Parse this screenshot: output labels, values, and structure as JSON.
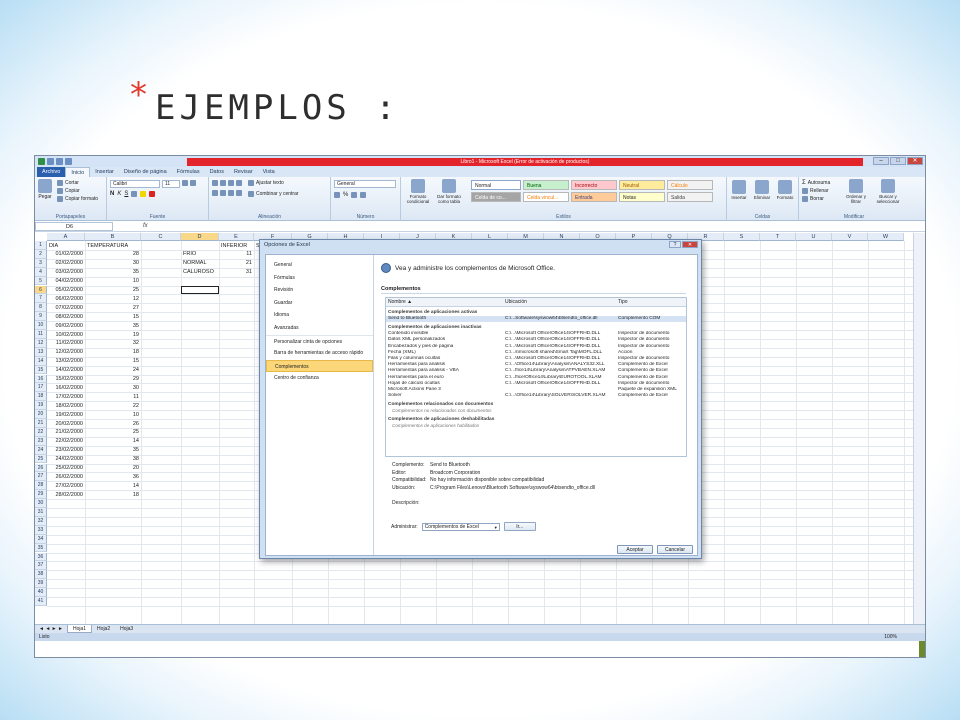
{
  "slide": {
    "star": "*",
    "title": "EJEMPLOS :"
  },
  "window": {
    "title": "Libro1 - Microsoft Excel (Error de activación de productos)",
    "controls": [
      "–",
      "□",
      "✕"
    ]
  },
  "ribbon_tabs": [
    "Archivo",
    "Inicio",
    "Insertar",
    "Diseño de página",
    "Fórmulas",
    "Datos",
    "Revisar",
    "Vista"
  ],
  "ribbon": {
    "clipboard": {
      "paste": "Pegar",
      "cut": "Cortar",
      "copy": "Copiar",
      "format": "Copiar formato",
      "label": "Portapapeles"
    },
    "font": {
      "name": "Calibri",
      "size": "11",
      "label": "Fuente"
    },
    "alignment": {
      "wrap": "Ajustar texto",
      "merge": "Combinar y centrar",
      "label": "Alineación"
    },
    "number": {
      "format": "General",
      "label": "Número"
    },
    "styles": {
      "cond": "Formato condicional",
      "table": "Dar formato como tabla",
      "cells": [
        "Normal",
        "Buena",
        "Incorrecto",
        "Neutral",
        "Cálculo",
        "Celda de co...",
        "Celda vincul...",
        "Entrada",
        "Notas",
        "Salida"
      ],
      "label": "Estilos"
    },
    "cells": {
      "insert": "Insertar",
      "delete": "Eliminar",
      "format": "Formato",
      "label": "Celdas"
    },
    "editing": {
      "autosum": "Autosuma",
      "fill": "Rellenar",
      "clear": "Borrar",
      "sort": "Ordenar y filtrar",
      "find": "Buscar y seleccionar",
      "label": "Modificar"
    }
  },
  "formula_bar": {
    "name_box": "D6",
    "fx": "fx"
  },
  "columns": [
    "A",
    "B",
    "C",
    "D",
    "E",
    "F",
    "G",
    "H",
    "I",
    "J",
    "K",
    "L",
    "M",
    "N",
    "O",
    "P",
    "Q",
    "R",
    "S",
    "T",
    "U",
    "V",
    "W"
  ],
  "sheet": {
    "headers": {
      "a": "DIA",
      "b": "TEMPERATURA",
      "e": "INFERIOR",
      "f": "SUPER"
    },
    "rows": [
      [
        "01/02/2000",
        "28"
      ],
      [
        "02/02/2000",
        "30"
      ],
      [
        "03/02/2000",
        "35"
      ],
      [
        "04/02/2000",
        "10"
      ],
      [
        "05/02/2000",
        "25"
      ],
      [
        "06/02/2000",
        "12"
      ],
      [
        "07/02/2000",
        "27"
      ],
      [
        "08/02/2000",
        "15"
      ],
      [
        "09/02/2000",
        "35"
      ],
      [
        "10/02/2000",
        "19"
      ],
      [
        "11/02/2000",
        "32"
      ],
      [
        "12/02/2000",
        "18"
      ],
      [
        "13/02/2000",
        "15"
      ],
      [
        "14/02/2000",
        "24"
      ],
      [
        "15/02/2000",
        "29"
      ],
      [
        "16/02/2000",
        "30"
      ],
      [
        "17/02/2000",
        "11"
      ],
      [
        "18/02/2000",
        "22"
      ],
      [
        "19/02/2000",
        "10"
      ],
      [
        "20/02/2000",
        "26"
      ],
      [
        "21/02/2000",
        "25"
      ],
      [
        "22/02/2000",
        "14"
      ],
      [
        "23/02/2000",
        "35"
      ],
      [
        "24/02/2000",
        "38"
      ],
      [
        "25/02/2000",
        "20"
      ],
      [
        "26/02/2000",
        "36"
      ],
      [
        "27/02/2000",
        "14"
      ],
      [
        "28/02/2000",
        "18"
      ]
    ],
    "ranges": [
      [
        "FRIO",
        "11"
      ],
      [
        "NORMAL",
        "21"
      ],
      [
        "CALUROSO",
        "31"
      ]
    ],
    "row_count": 41
  },
  "sheet_tabs": [
    "Hoja1",
    "Hoja2",
    "Hoja3"
  ],
  "status": {
    "mode": "Listo",
    "zoom": "100%"
  },
  "dialog": {
    "title": "Opciones de Excel",
    "nav": [
      "General",
      "Fórmulas",
      "Revisión",
      "Guardar",
      "Idioma",
      "Avanzadas",
      "Personalizar cinta de opciones",
      "Barra de herramientas de acceso rápido",
      "Complementos",
      "Centro de confianza"
    ],
    "active_nav": "Complementos",
    "heading": "Vea y administre los complementos de Microsoft Office.",
    "section": "Complementos",
    "table_headers": [
      "Nombre ▲",
      "Ubicación",
      "Tipo"
    ],
    "groups": [
      {
        "title": "Complementos de aplicaciones activas",
        "rows": [
          [
            "Send to Bluetooth",
            "C:\\...Software\\syswow64\\btsendto_office.dll",
            "Complemento COM"
          ]
        ]
      },
      {
        "title": "Complementos de aplicaciones inactivas",
        "rows": [
          [
            "Contenido invisible",
            "C:\\...\\Microsoft Office\\Office14\\OFFRHD.DLL",
            "Inspector de documento"
          ],
          [
            "Datos XML personalizados",
            "C:\\...\\Microsoft Office\\Office14\\OFFRHD.DLL",
            "Inspector de documento"
          ],
          [
            "Encabezados y pies de página",
            "C:\\...\\Microsoft Office\\Office14\\OFFRHD.DLL",
            "Inspector de documento"
          ],
          [
            "Fecha (XML)",
            "C:\\...s\\microsoft shared\\Smart Tag\\MOFL.DLL",
            "Acción"
          ],
          [
            "Filas y columnas ocultas",
            "C:\\...\\Microsoft Office\\Office14\\OFFRHD.DLL",
            "Inspector de documento"
          ],
          [
            "Herramientas para análisis",
            "C:\\...\\Office14\\Library\\Analysis\\ANALYS32.XLL",
            "Complemento de Excel"
          ],
          [
            "Herramientas para análisis - VBA",
            "C:\\...ffice14\\Library\\Analysis\\ATPVBAEN.XLAM",
            "Complemento de Excel"
          ],
          [
            "Herramientas para el euro",
            "C:\\...ffice\\Office14\\Library\\EUROTOOL.XLAM",
            "Complemento de Excel"
          ],
          [
            "Hojas de cálculo ocultas",
            "C:\\...\\Microsoft Office\\Office14\\OFFRHD.DLL",
            "Inspector de documento"
          ],
          [
            "Microsoft Actions Pane 3",
            "",
            "Paquete de expansión XML"
          ],
          [
            "Solver",
            "C:\\...\\Office14\\Library\\SOLVER\\SOLVER.XLAM",
            "Complemento de Excel"
          ]
        ]
      },
      {
        "title": "Complementos relacionados con documentos",
        "empty": "Complementos no relacionados con documentos"
      },
      {
        "title": "Complementos de aplicaciones deshabilitadas",
        "empty": "Complementos de aplicaciones habilitados"
      }
    ],
    "details": [
      [
        "Complemento:",
        "Send to Bluetooth"
      ],
      [
        "Editor:",
        "Broadcom Corporation"
      ],
      [
        "Compatibilidad:",
        "No hay información disponible sobre compatibilidad"
      ],
      [
        "Ubicación:",
        "C:\\Program Files\\Lenovo\\Bluetooth Software\\syswow64\\btsendto_office.dll"
      ],
      [
        "",
        ""
      ],
      [
        "Descripción:",
        ""
      ]
    ],
    "manage_label": "Administrar:",
    "manage_value": "Complementos de Excel",
    "go": "Ir...",
    "ok": "Aceptar",
    "cancel": "Cancelar"
  }
}
